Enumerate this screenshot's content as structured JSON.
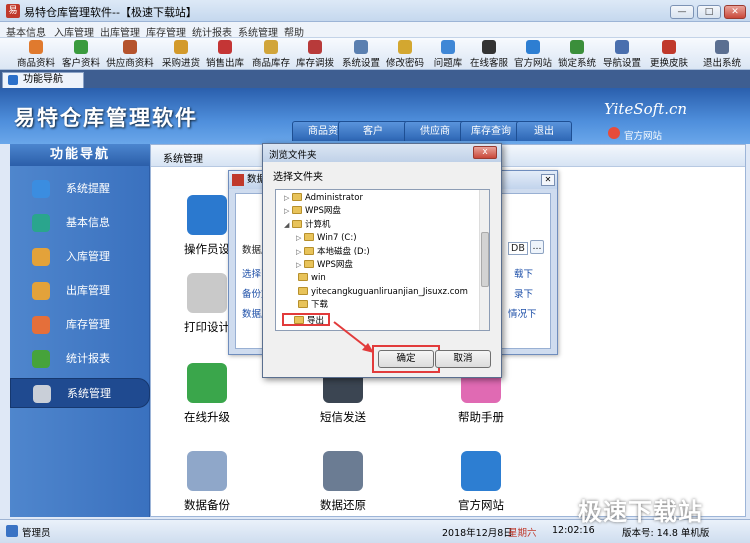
{
  "window": {
    "title": "易特仓库管理软件--【极速下载站】",
    "min": "—",
    "max": "□",
    "close": "✕"
  },
  "menu": [
    "基本信息",
    "入库管理",
    "出库管理",
    "库存管理",
    "统计报表",
    "系统管理",
    "帮助"
  ],
  "toolbar": [
    {
      "label": "商品资料",
      "color": "#e07a2e"
    },
    {
      "label": "客户资料",
      "color": "#3a9b3e"
    },
    {
      "label": "供应商资料",
      "color": "#b5532c"
    },
    {
      "label": "采购进货",
      "color": "#d39a2b"
    },
    {
      "label": "销售出库",
      "color": "#c43535"
    },
    {
      "label": "商品库存",
      "color": "#d1a53a"
    },
    {
      "label": "库存调拨",
      "color": "#b83a3a"
    },
    {
      "label": "系统设置",
      "color": "#5a7fb0"
    },
    {
      "label": "修改密码",
      "color": "#d3a730"
    },
    {
      "label": "问题库",
      "color": "#3f87d6"
    },
    {
      "label": "在线客服",
      "color": "#333333"
    },
    {
      "label": "官方网站",
      "color": "#2d7ed2"
    },
    {
      "label": "锁定系统",
      "color": "#3b8f3b"
    },
    {
      "label": "导航设置",
      "color": "#4a6fae"
    },
    {
      "label": "更换皮肤",
      "color": "#c0392b"
    },
    {
      "label": "退出系统",
      "color": "#5b6f91"
    }
  ],
  "tab": {
    "label": "功能导航"
  },
  "banner": {
    "title": "易特仓库管理软件",
    "brand": "YiteSoft.cn",
    "site_link": "官方网站",
    "tabs": [
      "商品资料",
      "客户",
      "供应商",
      "库存查询",
      "退出"
    ]
  },
  "nav": {
    "heading": "功能导航",
    "items": [
      {
        "label": "系统提醒",
        "color": "#3b8de0"
      },
      {
        "label": "基本信息",
        "color": "#2aa58d"
      },
      {
        "label": "入库管理",
        "color": "#e3a23a"
      },
      {
        "label": "出库管理",
        "color": "#e3a23a"
      },
      {
        "label": "库存管理",
        "color": "#e56f3a"
      },
      {
        "label": "统计报表",
        "color": "#46a33b"
      },
      {
        "label": "系统管理",
        "color": "#c9cfd8"
      }
    ]
  },
  "main": {
    "heading": "系统管理",
    "features": [
      {
        "label": "操作员设",
        "color": "#2b79cf"
      },
      {
        "label": "打印设计",
        "color": "#c9c9c9"
      },
      {
        "label": "在线升级",
        "color": "#3aa64b"
      },
      {
        "label": "短信发送",
        "color": "#3b4552"
      },
      {
        "label": "帮助手册",
        "color": "#e06ab3"
      },
      {
        "label": "数据备份",
        "color": "#8fa7c9"
      },
      {
        "label": "数据还原",
        "color": "#6b7c93"
      },
      {
        "label": "官方网站",
        "color": "#2d7ed2"
      }
    ]
  },
  "bg_dialog": {
    "title": "数据",
    "left_text": [
      "数据库",
      "选择了",
      "备份文",
      "数据库"
    ],
    "right_text": [
      "载下",
      "录下",
      "情况下"
    ],
    "db_field": "DB"
  },
  "browse_dialog": {
    "title": "浏览文件夹",
    "close": "x",
    "prompt": "选择文件夹",
    "tree": [
      {
        "label": "Administrator",
        "twisty": "▷"
      },
      {
        "label": "WPS网盘",
        "twisty": "▷"
      },
      {
        "label": "计算机",
        "twisty": "◢"
      },
      {
        "label": "Win7 (C:)",
        "twisty": "▷"
      },
      {
        "label": "本地磁盘 (D:)",
        "twisty": "▷"
      },
      {
        "label": "WPS网盘",
        "twisty": "▷"
      },
      {
        "label": "win",
        "twisty": ""
      },
      {
        "label": "yitecangkuguanliruanjian_Jisuxz.com",
        "twisty": ""
      },
      {
        "label": "下载",
        "twisty": ""
      },
      {
        "label": "导出",
        "twisty": ""
      }
    ],
    "ok": "确定",
    "cancel": "取消"
  },
  "status": {
    "user": "管理员",
    "date": "2018年12月8日",
    "weekday": "星期六",
    "time": "12:02:16",
    "version": "版本号: 14.8 单机版"
  },
  "watermark": "极速下载站"
}
